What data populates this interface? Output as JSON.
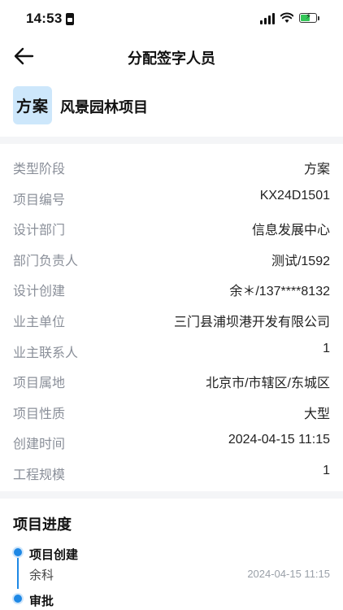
{
  "status_bar": {
    "time": "14:53"
  },
  "nav": {
    "title": "分配签字人员"
  },
  "project": {
    "stage_badge": "方案",
    "name": "风景园林项目"
  },
  "details": [
    {
      "label": "类型阶段",
      "value": "方案"
    },
    {
      "label": "项目编号",
      "value": "KX24D1501"
    },
    {
      "label": "设计部门",
      "value": "信息发展中心"
    },
    {
      "label": "部门负责人",
      "value": "测试/1592"
    },
    {
      "label": "设计创建",
      "value": "余＊/137****8132"
    },
    {
      "label": "业主单位",
      "value": "三门县浦坝港开发有限公司"
    },
    {
      "label": "业主联系人",
      "value": "1"
    },
    {
      "label": "项目属地",
      "value": "北京市/市辖区/东城区"
    },
    {
      "label": "项目性质",
      "value": "大型"
    },
    {
      "label": "创建时间",
      "value": "2024-04-15 11:15"
    },
    {
      "label": "工程规模",
      "value": "1"
    }
  ],
  "progress": {
    "title": "项目进度",
    "steps": [
      {
        "name": "项目创建",
        "person": "余科",
        "time": "2024-04-15 11:15"
      },
      {
        "name": "审批",
        "person": "",
        "time": ""
      }
    ]
  },
  "colors": {
    "accent": "#1e88e5",
    "badge_bg": "#cde7fb",
    "label_gray": "#8a8f99",
    "divider": "#f4f5f7"
  }
}
